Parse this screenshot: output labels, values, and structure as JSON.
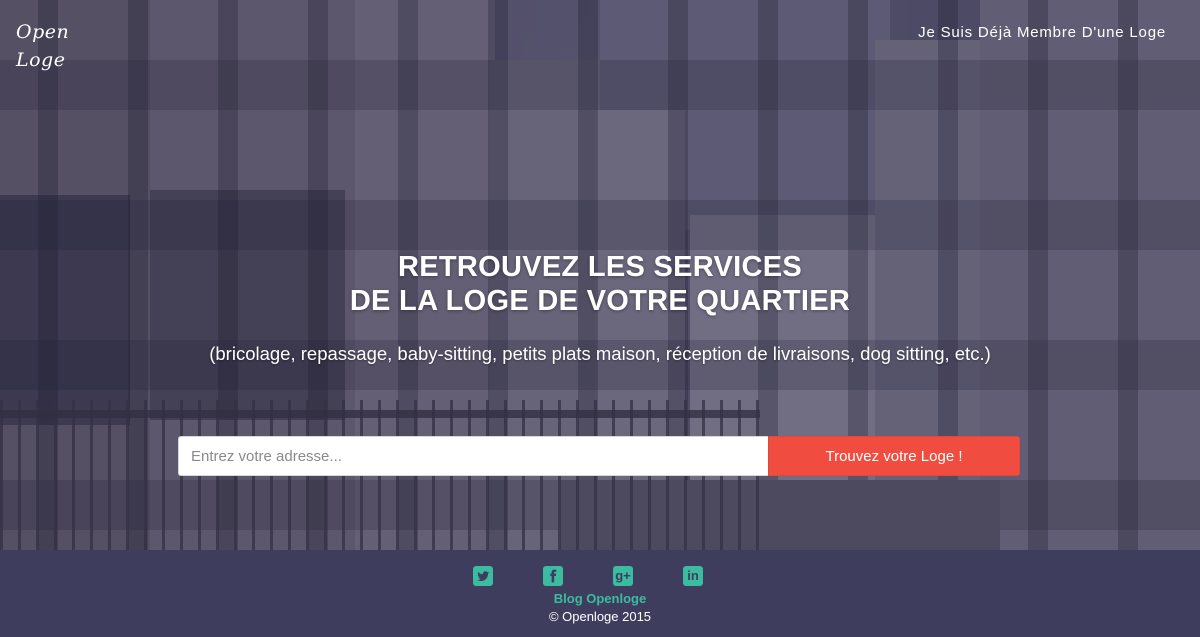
{
  "header": {
    "logo_line1": "Open",
    "logo_line2": "Loge",
    "member_link": "Je Suis Déjà Membre D'une Loge"
  },
  "hero": {
    "headline_line1": "RETROUVEZ LES SERVICES",
    "headline_line2": "DE LA LOGE DE VOTRE QUARTIER",
    "subline": "(bricolage, repassage, baby-sitting, petits plats maison, réception de livraisons, dog sitting, etc.)"
  },
  "search": {
    "placeholder": "Entrez votre adresse...",
    "value": "",
    "button_label": "Trouvez votre Loge !"
  },
  "footer": {
    "social": [
      {
        "name": "twitter-icon"
      },
      {
        "name": "facebook-icon"
      },
      {
        "name": "google-plus-icon",
        "glyph": "g+"
      },
      {
        "name": "linkedin-icon",
        "glyph": "in"
      }
    ],
    "blog_link": "Blog Openloge",
    "copyright": "© Openloge 2015"
  },
  "colors": {
    "accent_button": "#f04c3f",
    "footer_bg": "#3f3d5e",
    "footer_accent": "#3bbca0",
    "hero_overlay": "#3a3858"
  }
}
